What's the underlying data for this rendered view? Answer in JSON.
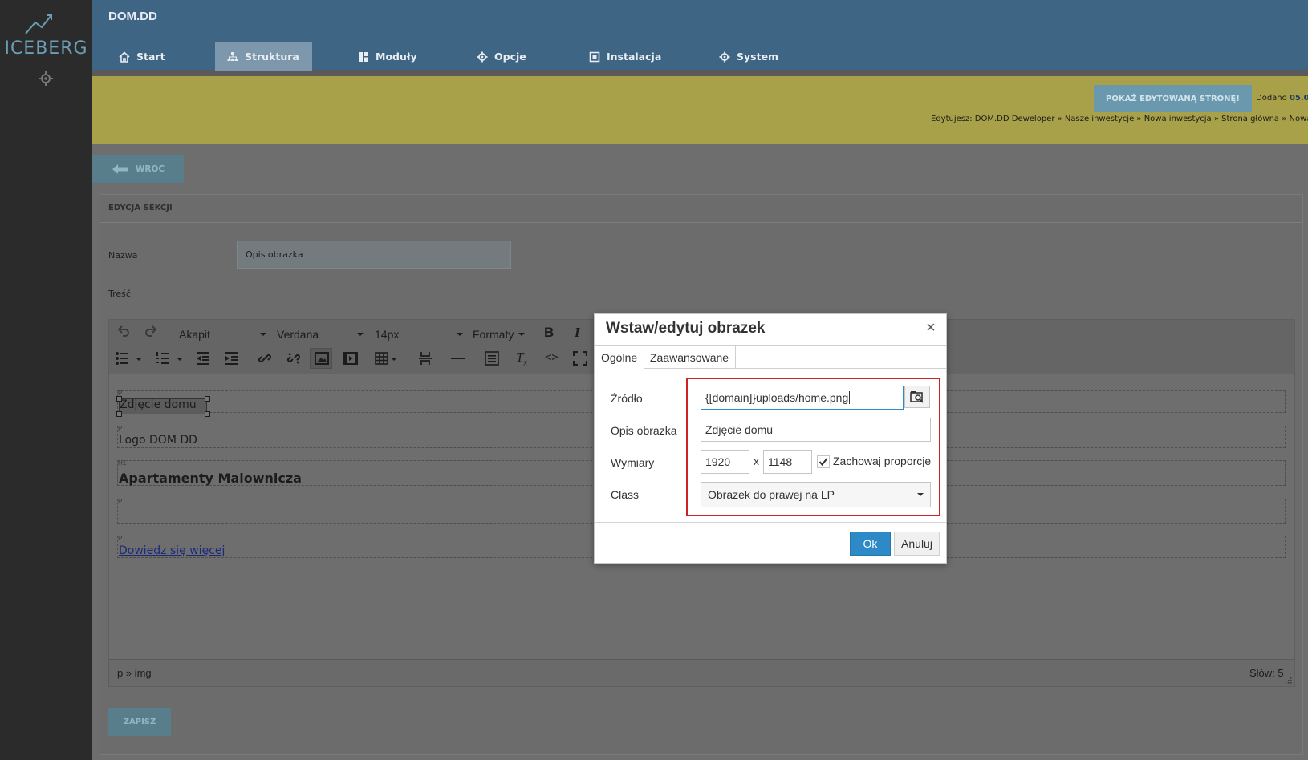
{
  "sidebar": {
    "logo": "ICEBERG",
    "icons": [
      "chart-line-icon",
      "gear-icon"
    ]
  },
  "header": {
    "site_name": "DOM.DD",
    "tabs": [
      {
        "label": "Start",
        "icon": "home-icon",
        "active": false
      },
      {
        "label": "Struktura",
        "icon": "sitemap-icon",
        "active": true
      },
      {
        "label": "Moduły",
        "icon": "modules-icon",
        "active": false
      },
      {
        "label": "Opcje",
        "icon": "gear-icon",
        "active": false
      },
      {
        "label": "Instalacja",
        "icon": "install-icon",
        "active": false
      },
      {
        "label": "System",
        "icon": "gear-icon",
        "active": false
      }
    ]
  },
  "infobar": {
    "show_button": "POKAŻ EDYTOWANĄ STRONĘ!",
    "added_label": "Dodano",
    "added_date": "05.0",
    "editing": "Edytujesz: DOM.DD Deweloper » Nasze inwestycje » Nowa inwestycja » Strona główna » Nowa i"
  },
  "page": {
    "back_button": "WRÓĆ",
    "panel_title": "EDYCJA SEKCJI",
    "name_label": "Nazwa",
    "name_value": "Opis obrazka",
    "content_label": "Treść",
    "save_button": "ZAPISZ"
  },
  "editor": {
    "format_select": "Akapit",
    "font_select": "Verdana",
    "size_select": "14px",
    "formats_select": "Formaty",
    "blocks": [
      {
        "tag": "P",
        "text": "Zdjęcie domu"
      },
      {
        "tag": "P",
        "text": "Logo DOM DD"
      },
      {
        "tag": "H1",
        "text": "Apartamenty Malownicza"
      },
      {
        "tag": "P",
        "text": ""
      },
      {
        "tag": "P",
        "text": "Dowiedz się więcej"
      }
    ],
    "path": "p » img",
    "wordcount": "Słów: 5"
  },
  "dialog": {
    "title": "Wstaw/edytuj obrazek",
    "close": "×",
    "tabs": [
      "Ogólne",
      "Zaawansowane"
    ],
    "source_label": "Źródło",
    "source_value": "{[domain]}uploads/home.png",
    "alt_label": "Opis obrazka",
    "alt_value": "Zdjęcie domu",
    "dims_label": "Wymiary",
    "width": "1920",
    "height": "1148",
    "dims_sep": "x",
    "keep_ratio_label": "Zachowaj proporcje",
    "keep_ratio": true,
    "class_label": "Class",
    "class_value": "Obrazek do prawej na LP",
    "ok": "Ok",
    "cancel": "Anuluj"
  },
  "colors": {
    "header": "#3f6585",
    "sidebar": "#2b2b2b",
    "accent": "#2d8ac7",
    "highlight": "#cc2222"
  }
}
